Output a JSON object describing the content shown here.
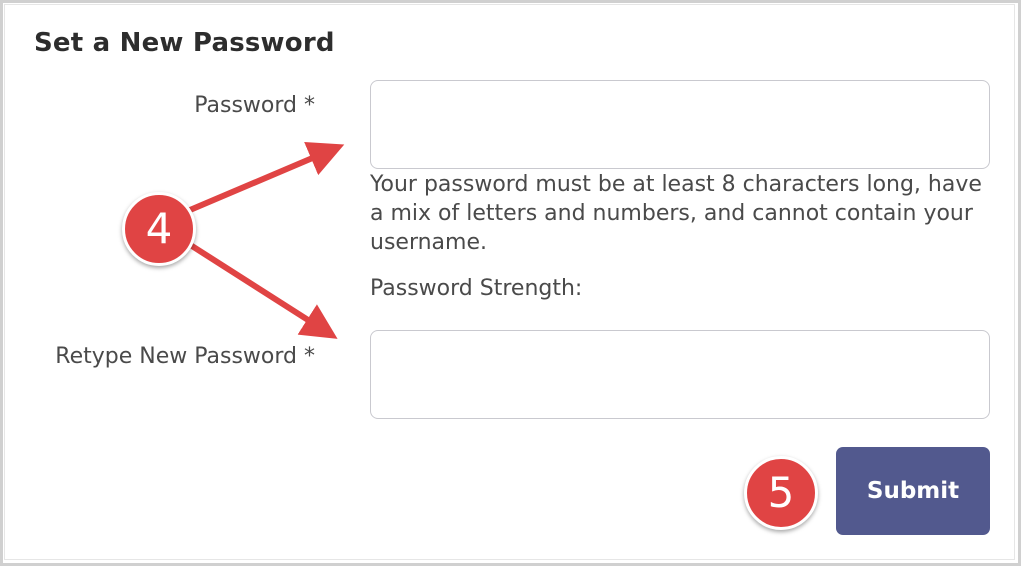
{
  "form": {
    "title": "Set a New Password",
    "password_label": "Password *",
    "password_value": "",
    "password_hint": "Your password must be at least 8 characters long, have a mix of letters and numbers, and cannot contain your username.",
    "strength_label": "Password Strength:",
    "retype_label": "Retype New Password *",
    "retype_value": "",
    "submit_label": "Submit"
  },
  "annotations": {
    "step_fields": "4",
    "step_submit": "5",
    "badge_color": "#e04444",
    "arrow_color": "#e04444"
  },
  "colors": {
    "button_bg": "#52598e",
    "heading": "#2d2d2d",
    "text": "#4a4a4a",
    "field_border": "#c9c9cf"
  }
}
